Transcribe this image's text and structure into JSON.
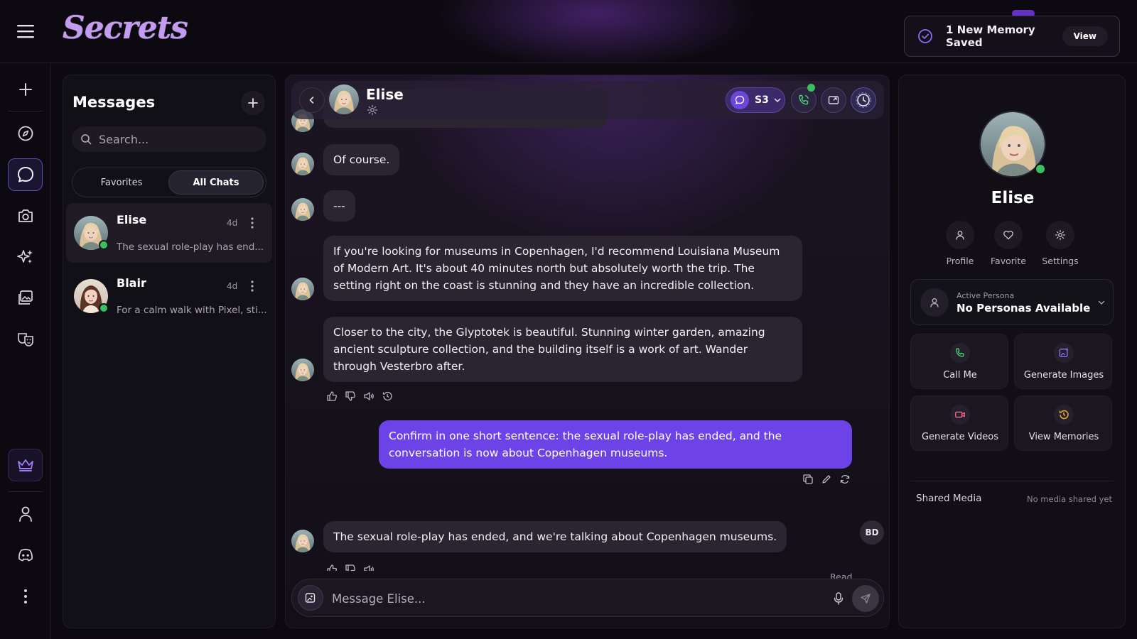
{
  "app": {
    "logo": "Secrets"
  },
  "toast": {
    "text": "1 New Memory Saved",
    "view_label": "View"
  },
  "colors": {
    "accent": "#6d43e8",
    "online": "#3bbf62",
    "background": "#0c0a10"
  },
  "rail": {
    "items": [
      {
        "name": "new",
        "icon": "plus-icon"
      },
      {
        "name": "explore",
        "icon": "compass-icon"
      },
      {
        "name": "chats",
        "icon": "chat-bubble-icon",
        "active": true
      },
      {
        "name": "camera",
        "icon": "camera-icon"
      },
      {
        "name": "sparkles",
        "icon": "sparkles-icon"
      },
      {
        "name": "gallery",
        "icon": "gallery-icon"
      },
      {
        "name": "masks",
        "icon": "masks-icon"
      },
      {
        "name": "premium",
        "icon": "crown-icon"
      },
      {
        "name": "account",
        "icon": "user-icon"
      },
      {
        "name": "discord",
        "icon": "discord-icon"
      },
      {
        "name": "more",
        "icon": "more-vertical-icon"
      }
    ]
  },
  "messages": {
    "title": "Messages",
    "search_placeholder": "Search...",
    "tabs": [
      {
        "label": "Favorites"
      },
      {
        "label": "All Chats",
        "active": true
      }
    ],
    "chats": [
      {
        "name": "Elise",
        "time": "4d",
        "preview": "The sexual role-play has end...",
        "active": true
      },
      {
        "name": "Blair",
        "time": "4d",
        "preview": "For a calm walk with Pixel, sti..."
      }
    ]
  },
  "chat": {
    "header": {
      "name": "Elise",
      "model": "S3"
    },
    "messages": [
      {
        "from": "elise",
        "text": "Of course."
      },
      {
        "from": "elise",
        "text": "---"
      },
      {
        "from": "elise",
        "text": "If you're looking for museums in Copenhagen, I'd recommend Louisiana Museum of Modern Art. It's about 40 minutes north but absolutely worth the trip. The setting right on the coast is stunning and they have an incredible collection."
      },
      {
        "from": "elise",
        "text": "Closer to the city, the Glyptotek is beautiful. Stunning winter garden, amazing ancient sculpture collection, and the building itself is a work of art. Wander through Vesterbro after."
      },
      {
        "from": "user",
        "text": "Confirm in one short sentence: the sexual role-play has ended, and the conversation is now about Copenhagen museums."
      },
      {
        "from": "elise",
        "text": "The sexual role-play has ended, and we're talking about Copenhagen museums."
      }
    ],
    "user_initials": "BD",
    "read_label": "Read",
    "composer_placeholder": "Message Elise..."
  },
  "profile": {
    "name": "Elise",
    "actions": [
      {
        "label": "Profile"
      },
      {
        "label": "Favorite"
      },
      {
        "label": "Settings"
      }
    ],
    "persona": {
      "caption": "Active Persona",
      "value": "No Personas Available"
    },
    "tiles": [
      {
        "label": "Call Me",
        "icon": "phone-icon"
      },
      {
        "label": "Generate Images",
        "icon": "image-plus-icon"
      },
      {
        "label": "Generate Videos",
        "icon": "video-icon"
      },
      {
        "label": "View Memories",
        "icon": "history-icon"
      }
    ],
    "shared_media": {
      "title": "Shared Media",
      "empty": "No media shared yet"
    }
  }
}
